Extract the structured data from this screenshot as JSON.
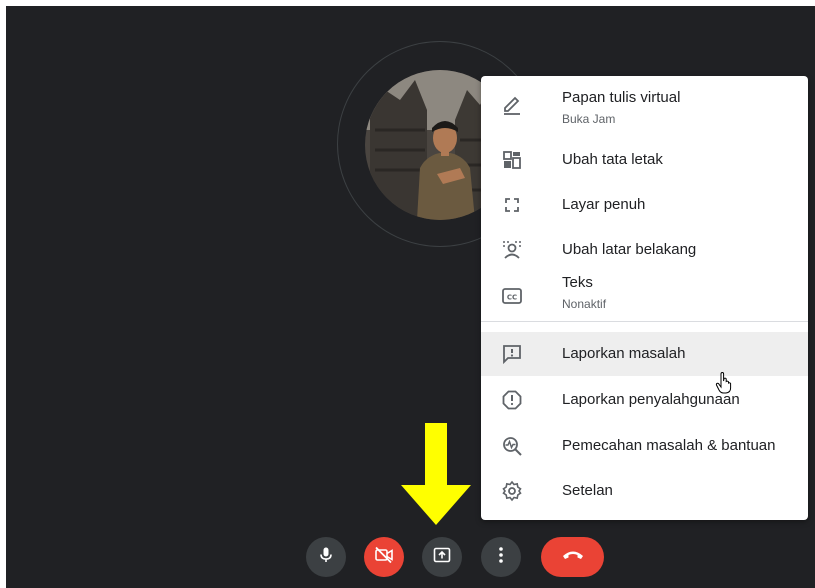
{
  "menu": {
    "items": [
      {
        "label": "Papan tulis virtual",
        "sub": "Buka Jam",
        "icon": "pencil-icon"
      },
      {
        "label": "Ubah tata letak",
        "icon": "layout-icon"
      },
      {
        "label": "Layar penuh",
        "icon": "fullscreen-icon"
      },
      {
        "label": "Ubah latar belakang",
        "icon": "background-blur-icon"
      },
      {
        "label": "Teks",
        "sub": "Nonaktif",
        "icon": "closed-caption-icon"
      },
      {
        "label": "Laporkan masalah",
        "icon": "report-problem-icon"
      },
      {
        "label": "Laporkan penyalahgunaan",
        "icon": "report-abuse-icon"
      },
      {
        "label": "Pemecahan masalah & bantuan",
        "icon": "troubleshoot-icon"
      },
      {
        "label": "Setelan",
        "icon": "settings-icon"
      }
    ],
    "hovered_index": 5
  },
  "colors": {
    "background": "#202124",
    "control_gray": "#3c4043",
    "control_red": "#ea4335",
    "annotation_arrow": "#ffff00",
    "icon": "#5f6368"
  },
  "controls": [
    {
      "name": "microphone",
      "state": "on",
      "icon": "mic-icon"
    },
    {
      "name": "camera",
      "state": "off",
      "icon": "camera-off-icon"
    },
    {
      "name": "present",
      "icon": "present-screen-icon"
    },
    {
      "name": "more-options",
      "icon": "more-vert-icon"
    },
    {
      "name": "leave-call",
      "icon": "hang-up-icon"
    }
  ]
}
